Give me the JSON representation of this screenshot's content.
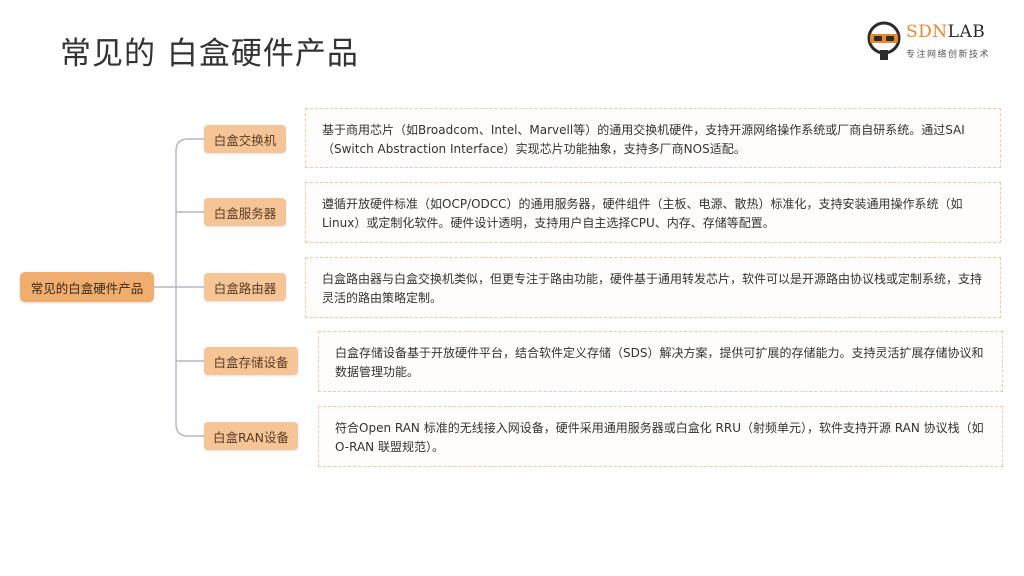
{
  "slide": {
    "title": "常见的 白盒硬件产品"
  },
  "logo": {
    "brand_part1": "SDN",
    "brand_part2": "LAB",
    "tagline": "专注网络创新技术"
  },
  "mindmap": {
    "root": "常见的白盒硬件产品",
    "branches": [
      {
        "label": "白盒交换机",
        "description": "基于商用芯片（如Broadcom、Intel、Marvell等）的通用交换机硬件，支持开源网络操作系统或厂商自研系统。通过SAI（Switch Abstraction Interface）实现芯片功能抽象，支持多厂商NOS适配。"
      },
      {
        "label": "白盒服务器",
        "description": "遵循开放硬件标准（如OCP/ODCC）的通用服务器，硬件组件（主板、电源、散热）标准化，支持安装通用操作系统（如 Linux）或定制化软件。硬件设计透明，支持用户自主选择CPU、内存、存储等配置。"
      },
      {
        "label": "白盒路由器",
        "description": "白盒路由器与白盒交换机类似，但更专注于路由功能，硬件基于通用转发芯片，软件可以是开源路由协议栈或定制系统，支持灵活的路由策略定制。"
      },
      {
        "label": "白盒存储设备",
        "description": "白盒存储设备基于开放硬件平台，结合软件定义存储（SDS）解决方案，提供可扩展的存储能力。支持灵活扩展存储协议和数据管理功能。"
      },
      {
        "label": "白盒RAN设备",
        "description": "符合Open RAN 标准的无线接入网设备，硬件采用通用服务器或白盒化 RRU（射频单元），软件支持开源 RAN 协议栈（如 O-RAN 联盟规范）。"
      }
    ]
  },
  "colors": {
    "root_fill": "#f0ad6e",
    "branch_fill": "#f5c598",
    "connector": "#b9b6c9",
    "card_border": "#f2c9a4",
    "logo_accent": "#e48a2a"
  }
}
